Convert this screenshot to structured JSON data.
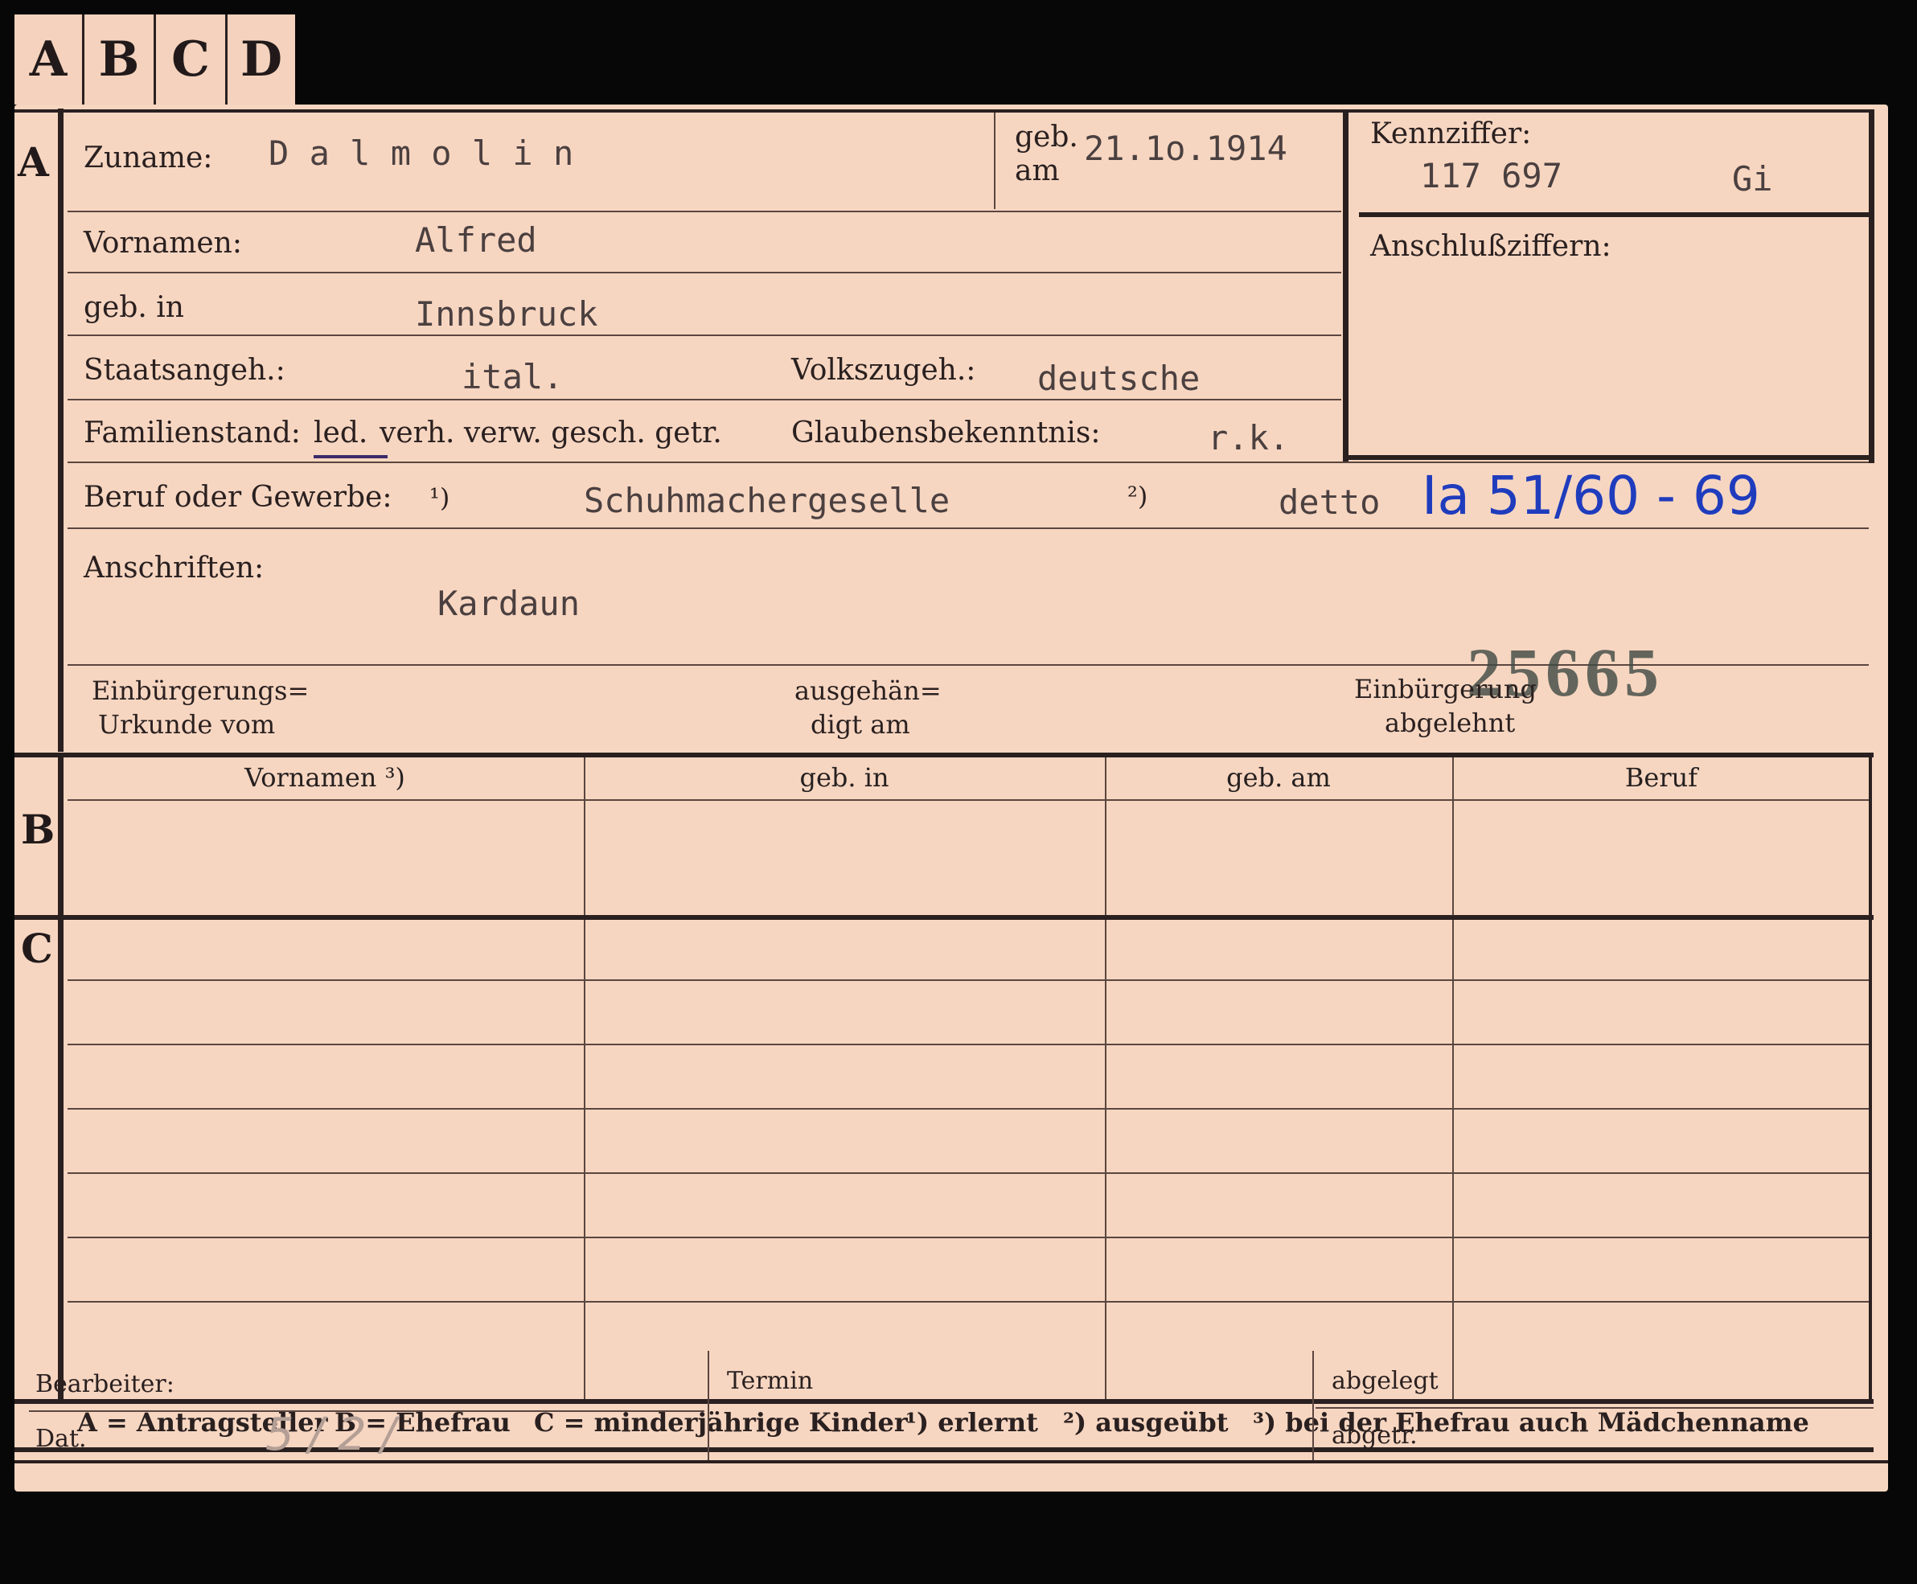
{
  "tabs": [
    "A",
    "B",
    "C",
    "D"
  ],
  "sections": {
    "a": "A",
    "b": "B",
    "c": "C"
  },
  "labels": {
    "zuname": "Zuname:",
    "geb_am_1": "geb.",
    "geb_am_2": "am",
    "kennziffer": "Kennziffer:",
    "anschlussziffern": "Anschlußziffern:",
    "vornamen": "Vornamen:",
    "geb_in": "geb. in",
    "staatsangeh": "Staatsangeh.:",
    "volkszugeh": "Volkszugeh.:",
    "familienstand": "Familienstand:",
    "fam_led": "led.",
    "fam_rest": "verh. verw. gesch. getr.",
    "glaubensbekenntnis": "Glaubensbekenntnis:",
    "beruf": "Beruf oder Gewerbe:",
    "note1": "¹)",
    "note2": "²)",
    "anschriften": "Anschriften:",
    "einb_urkunde_1": "Einbürgerungs=",
    "einb_urkunde_2": "Urkunde vom",
    "ausgehaendigt_1": "ausgehän=",
    "ausgehaendigt_2": "digt am",
    "einb_abgelehnt_1": "Einbürgerung",
    "einb_abgelehnt_2": "abgelehnt"
  },
  "values": {
    "zuname": "D a l m o l i n",
    "geb_am": "21.1o.1914",
    "kennziffer": "117 697",
    "kennziffer_suffix": "Gi",
    "vornamen": "Alfred",
    "geb_in": "Innsbruck",
    "staatsangeh": "ital.",
    "volkszugeh": "deutsche",
    "glaubensbekenntnis": "r.k.",
    "beruf_erlernt": "Schuhmachergeselle",
    "beruf_ausgeuebt": "detto",
    "handwritten_ref": "Ia 51/60 - 69",
    "anschrift": "Kardaun",
    "stamp_number": "25665"
  },
  "table": {
    "headers": [
      "Vornamen ³)",
      "geb. in",
      "geb. am",
      "Beruf"
    ]
  },
  "footer": {
    "legend_a": "A = Antragsteller",
    "legend_b": "B = Ehefrau",
    "legend_c": "C = minderjährige Kinder",
    "legend_1": "¹) erlernt",
    "legend_2": "²) ausgeübt",
    "legend_3": "³) bei der Ehefrau auch Mädchenname"
  },
  "bottom": {
    "bearbeiter": "Bearbeiter:",
    "dat": "Dat.",
    "dat_value": "5 / 2 /",
    "termin": "Termin",
    "abgelegt": "abgelegt",
    "abgetr": "abgetr."
  }
}
